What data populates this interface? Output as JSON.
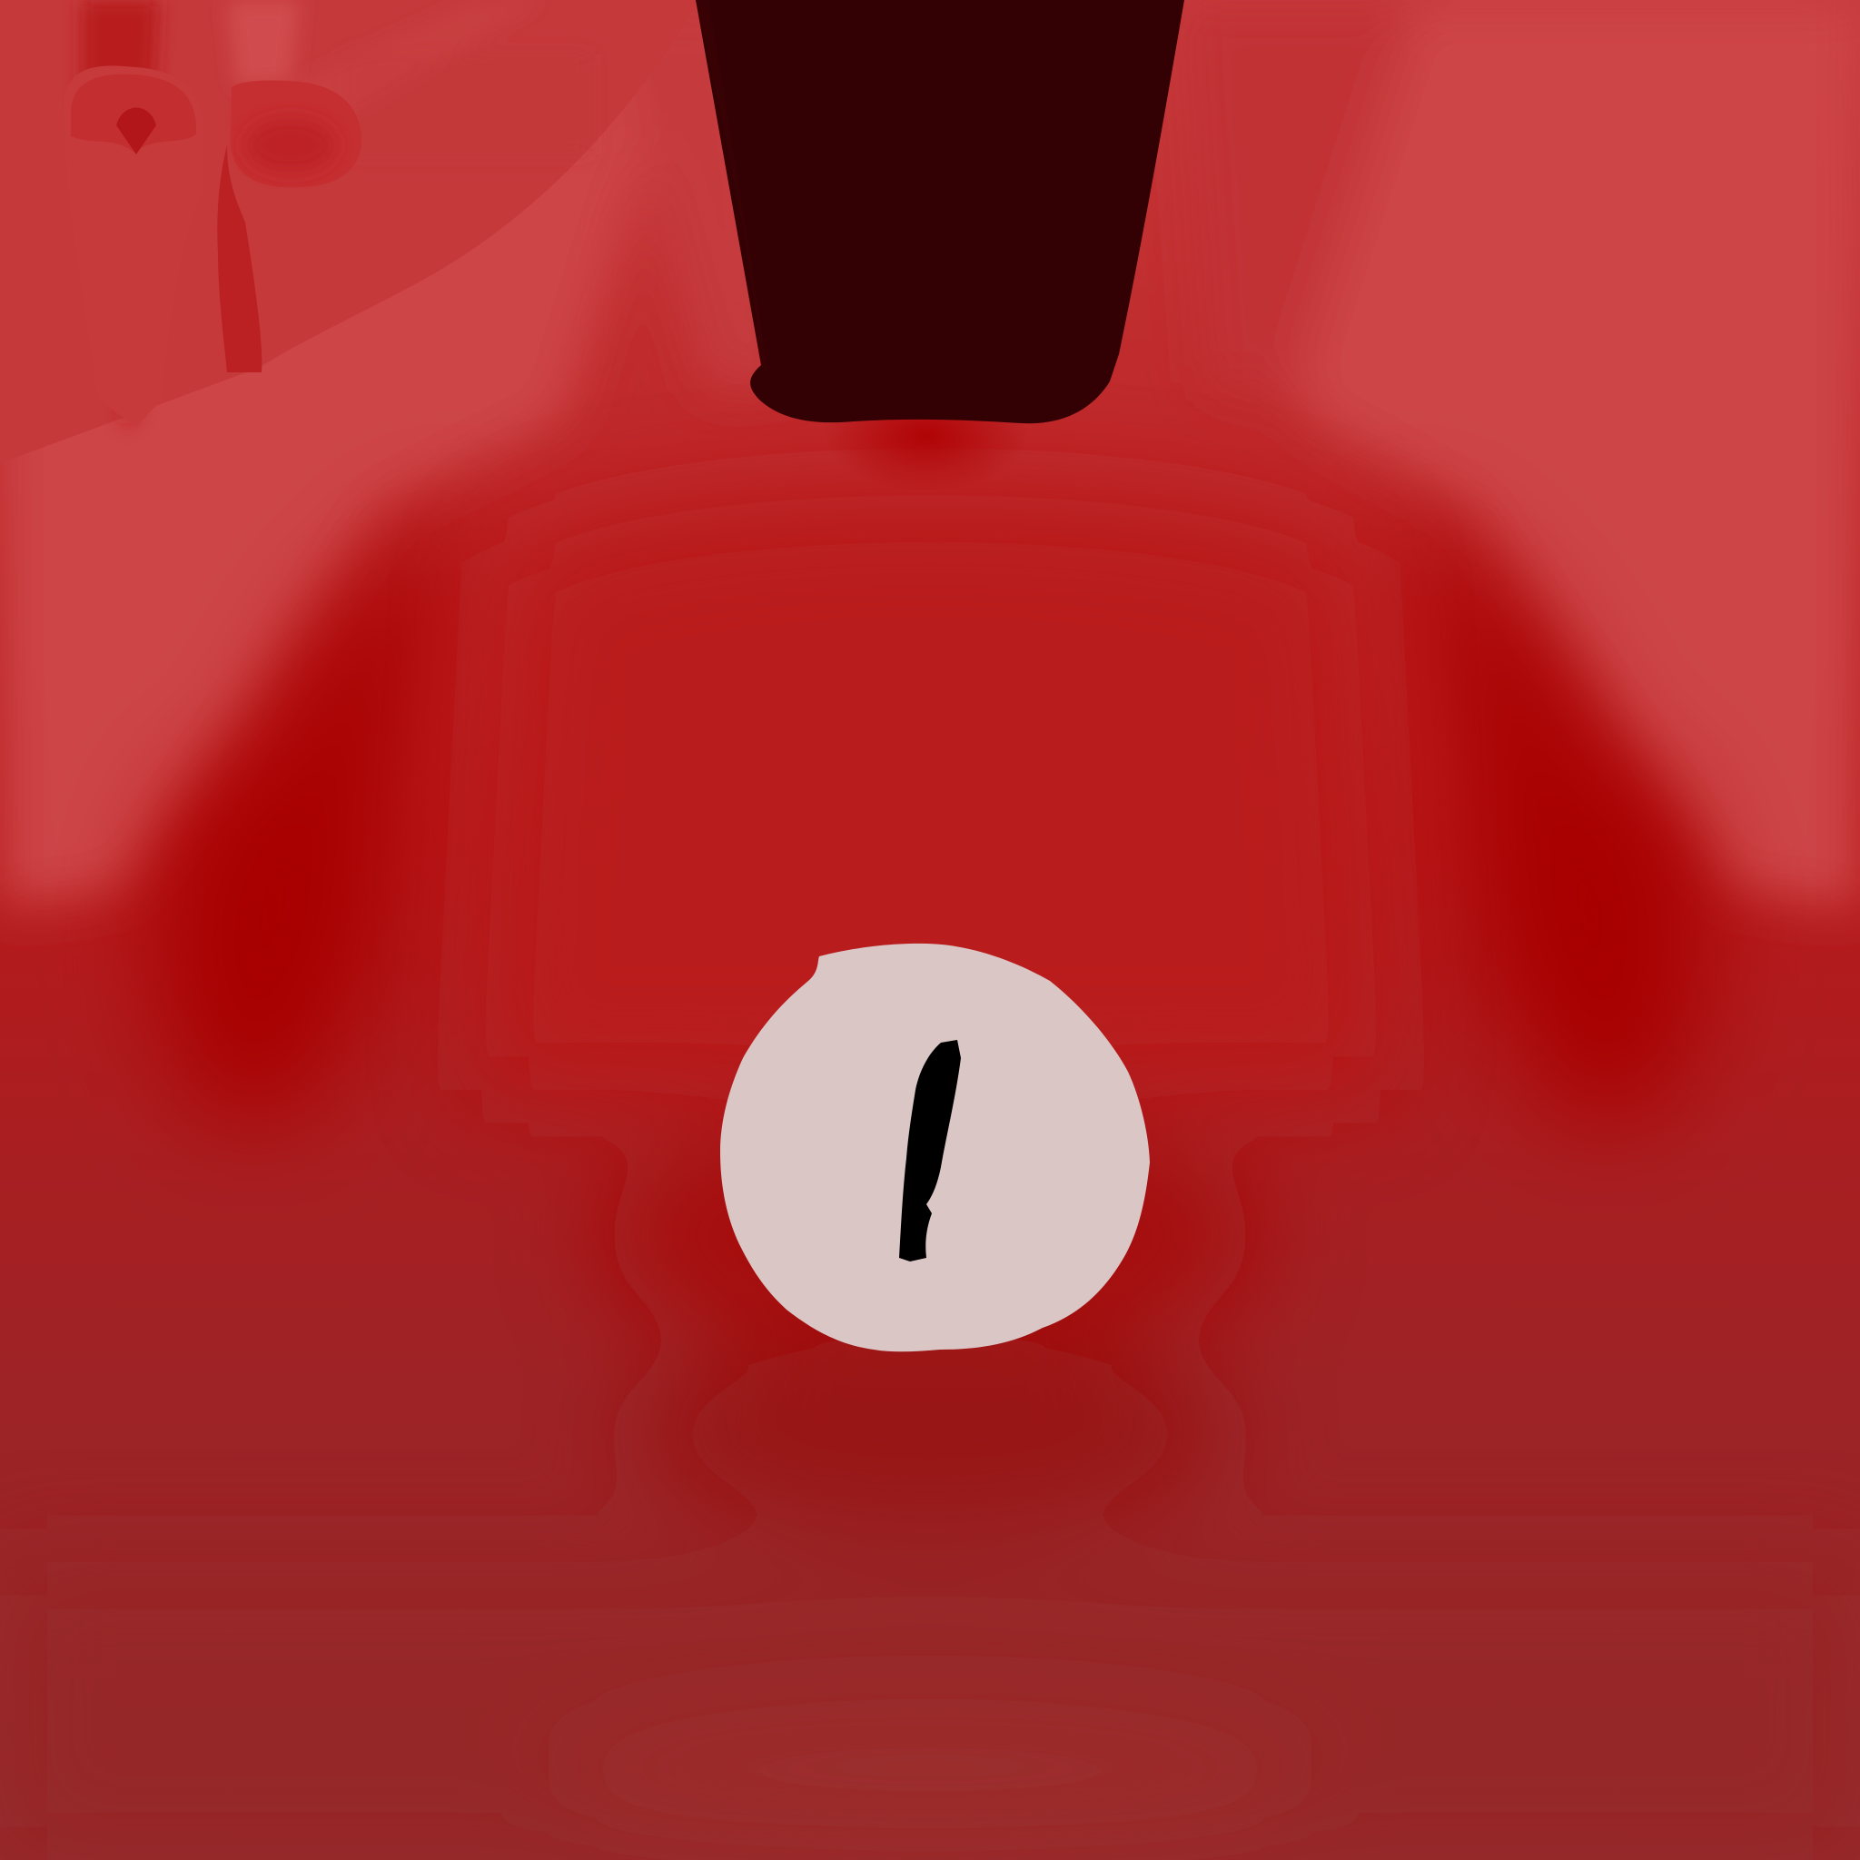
{
  "texture": {
    "kind": "character-shirt-texture",
    "colors": {
      "base_red": "#b8191b",
      "light_red": "#cc4446",
      "deep_red": "#a90608",
      "dark_red_bottom": "#962527",
      "collar_dark": "#330104",
      "button_face": "#dbc6c6",
      "stitch_mark": "#000000"
    },
    "icons": {
      "collar": "collar-opening-icon",
      "button": "button-icon",
      "pocket_pin_left": "pin-tab-icon",
      "pocket_pin_right": "pin-tab-icon"
    }
  }
}
